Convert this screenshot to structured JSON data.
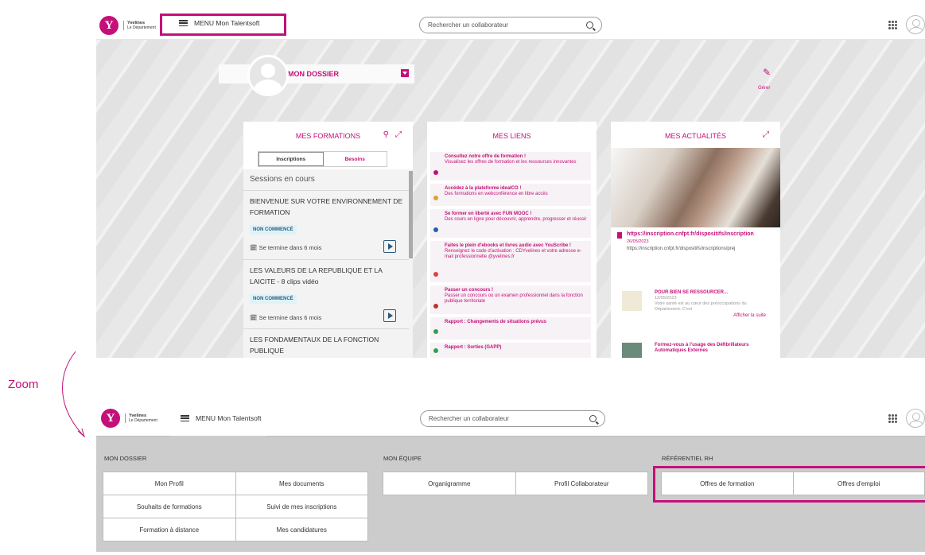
{
  "header": {
    "logo_name": "Yvelines",
    "logo_sub": "Le Département",
    "logo_letter": "Y",
    "menu_label": "MENU Mon Talentsoft",
    "search_placeholder": "Rechercher un collaborateur"
  },
  "dossier": {
    "title": "MON DOSSIER",
    "manage_label": "Gérer"
  },
  "formations": {
    "title": "MES FORMATIONS",
    "tabs": [
      "Inscriptions",
      "Besoins"
    ],
    "section": "Sessions en cours",
    "items": [
      {
        "title": "BIENVENUE SUR VOTRE ENVIRONNEMENT DE FORMATION",
        "status": "NON COMMENCÉ",
        "end": "Se termine dans 6 mois"
      },
      {
        "title": "LES VALEURS DE LA REPUBLIQUE ET LA LAICITE - 8 clips vidéo",
        "status": "NON COMMENCÉ",
        "end": "Se termine dans 6 mois"
      },
      {
        "title": "LES FONDAMENTAUX DE LA FONCTION PUBLIQUE"
      }
    ]
  },
  "liens": {
    "title": "MES LIENS",
    "items": [
      {
        "title": "Consultez notre offre de formation !",
        "desc": "Visualisez les offres de formation et les ressources innovantes",
        "color": "#c50f79"
      },
      {
        "title": "Accédez à la plateforme idealCO !",
        "desc": "Des formations en webconférence en libre accès",
        "color": "#e0a030"
      },
      {
        "title": "Se former en liberté avec FUN MOOC !",
        "desc": "Des cours en ligne pour découvrir, apprendre, progresser et réussir",
        "color": "#2060b0"
      },
      {
        "title": "Faites le plein d'ebooks et livres audio avec YouScribe !",
        "desc": "Renseignez le code d'activation : CDYvelines et votre adresse e-mail professionnelle @yvelines.fr",
        "color": "#e04040"
      },
      {
        "title": "Passer un concours !",
        "desc": "Passer un concours ou un examen professionnel dans la fonction publique territoriale",
        "color": "#c03030"
      },
      {
        "title": "Rapport : Changements de situations prévus",
        "desc": "",
        "color": "#30a050"
      },
      {
        "title": "Rapport : Sorties (GAPP)",
        "desc": "",
        "color": "#30a050"
      }
    ]
  },
  "actualites": {
    "title": "MES ACTUALITÉS",
    "link": "https://inscription.cnfpt.fr/dispositifs/inscription",
    "date": "26/05/2023",
    "url": "https://inscription.cnfpt.fr/dispositifs/inscriptions/prej",
    "items": [
      {
        "title": "POUR BIEN SE RESSOURCER...",
        "date": "12/05/2023",
        "desc": "Votre santé est au cœur des préoccupations du Département. C'est",
        "more": "Afficher la suite"
      },
      {
        "title": "Formez-vous à l'usage des Défibrillateurs Automatiques Externes"
      }
    ]
  },
  "zoom_label": "Zoom",
  "menu": {
    "sections": [
      {
        "title": "MON DOSSIER",
        "items": [
          "Mon Profil",
          "Mes documents",
          "Souhaits de formations",
          "Suivi de mes inscriptions",
          "Formation à distance",
          "Mes candidatures"
        ]
      },
      {
        "title": "MON ÉQUIPE",
        "items": [
          "Organigramme",
          "Profil Collaborateur"
        ]
      },
      {
        "title": "RÉFÉRENTIEL RH",
        "items": [
          "Offres de formation",
          "Offres d'emploi"
        ]
      }
    ]
  },
  "colors": {
    "brand": "#c50f79"
  }
}
